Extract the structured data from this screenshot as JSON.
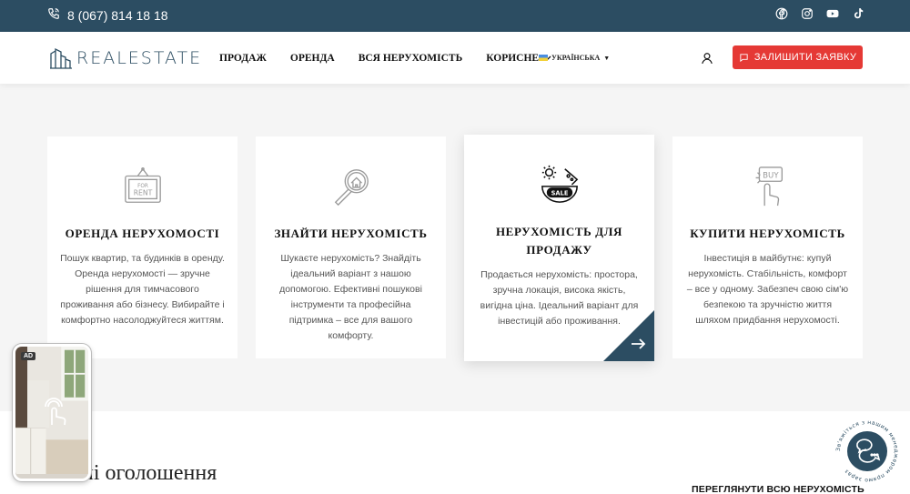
{
  "topbar": {
    "phone": "8 (067) 814 18 18",
    "socials": [
      "facebook-icon",
      "instagram-icon",
      "youtube-icon",
      "tiktok-icon"
    ],
    "bg_color": "#2c4d62"
  },
  "header": {
    "logo_text": "REALESTATE",
    "nav": [
      {
        "label": "ПРОДАЖ"
      },
      {
        "label": "ОРЕНДА"
      },
      {
        "label": "ВСЯ НЕРУХОМІСТЬ"
      },
      {
        "label": "КОРИСНЕ"
      }
    ],
    "language": "УКРАЇНСЬКА",
    "cta_label": "ЗАЛИШИТИ ЗАЯВКУ",
    "cta_color": "#e53935"
  },
  "cards": [
    {
      "icon": "for-rent-sign-icon",
      "title": "ОРЕНДА НЕРУХОМОСТІ",
      "desc": "Пошук квартир, та будинків в оренду. Оренда нерухомості — зручне рішення для тимчасового проживання або бізнесу. Вибирайте і комфортно насолоджуйтеся життям."
    },
    {
      "icon": "search-house-icon",
      "title": "ЗНАЙТИ НЕРУХОМІСТЬ",
      "desc": "Шукаєте нерухомість? Знайдіть ідеальний варіант з нашою допомогою. Ефективні пошукові інструменти та професійна підтримка – все для вашого комфорту."
    },
    {
      "icon": "sale-badge-icon",
      "title": "НЕРУХОМІСТЬ ДЛЯ ПРОДАЖУ",
      "desc": "Продається нерухомість: простора, зручна локація, висока якість, вигідна ціна. Ідеальний варіант для інвестицій або проживання."
    },
    {
      "icon": "buy-hand-icon",
      "title": "КУПИТИ НЕРУХОМІСТЬ",
      "desc": "Інвестиція в майбутнє: купуй нерухомість. Стабільність, комфорт – все у одному. Забезпеч свою сім'ю безпекою та зручністю життя шляхом придбання нерухомості."
    }
  ],
  "lower": {
    "heading": "ні оголошення",
    "view_all": "ПЕРЕГЛЯНУТИ ВСЮ НЕРУХОМІСТЬ"
  },
  "ad": {
    "badge": "AD"
  },
  "chat": {
    "ring_text": "Зв'яжіться з нашим менеджером прямо зараз"
  }
}
